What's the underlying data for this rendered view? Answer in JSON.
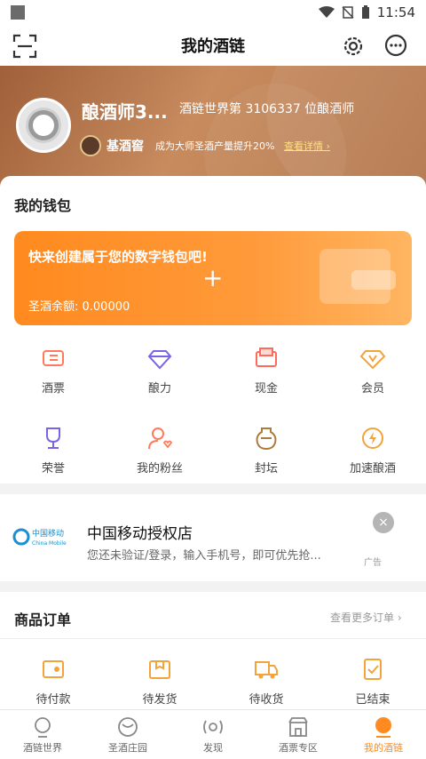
{
  "status_bar": {
    "time": "11:54"
  },
  "header": {
    "title": "我的酒链"
  },
  "profile": {
    "name": "酿酒师3...",
    "rank_text": "酒链世界第 3106337 位酿酒师",
    "level": "基酒窖",
    "tip": "成为大师圣酒产量提升20%",
    "detail_link": "查看详情",
    "detail_arrow": "›"
  },
  "wallet": {
    "section_title": "我的钱包",
    "cta": "快来创建属于您的数字钱包吧!",
    "plus": "+",
    "balance": "圣酒余额: 0.00000"
  },
  "grid1": [
    {
      "label": "酒票",
      "icon": "ticket-icon"
    },
    {
      "label": "酿力",
      "icon": "diamond-icon"
    },
    {
      "label": "现金",
      "icon": "cash-icon"
    },
    {
      "label": "会员",
      "icon": "vip-icon"
    }
  ],
  "grid2": [
    {
      "label": "荣誉",
      "icon": "trophy-icon"
    },
    {
      "label": "我的粉丝",
      "icon": "fans-icon"
    },
    {
      "label": "封坛",
      "icon": "jar-icon"
    },
    {
      "label": "加速酿酒",
      "icon": "lightning-icon"
    }
  ],
  "ad": {
    "logo_text": "中国移动",
    "logo_sub": "China Mobile",
    "title": "中国移动授权店",
    "desc": "您还未验证/登录，输入手机号，即可优先抢...",
    "close": "×",
    "tag": "广告"
  },
  "orders": {
    "title": "商品订单",
    "more": "查看更多订单 ›",
    "items": [
      {
        "label": "待付款",
        "icon": "wallet-icon"
      },
      {
        "label": "待发货",
        "icon": "package-icon"
      },
      {
        "label": "待收货",
        "icon": "truck-icon"
      },
      {
        "label": "已结束",
        "icon": "done-icon"
      }
    ]
  },
  "nav": [
    {
      "label": "酒链世界",
      "icon": "world-icon"
    },
    {
      "label": "圣酒庄园",
      "icon": "manor-icon"
    },
    {
      "label": "发现",
      "icon": "discover-icon"
    },
    {
      "label": "酒票专区",
      "icon": "shop-icon"
    },
    {
      "label": "我的酒链",
      "icon": "me-icon"
    }
  ],
  "colors": {
    "accent": "#ff8a1f",
    "banner": "#b2754a"
  }
}
